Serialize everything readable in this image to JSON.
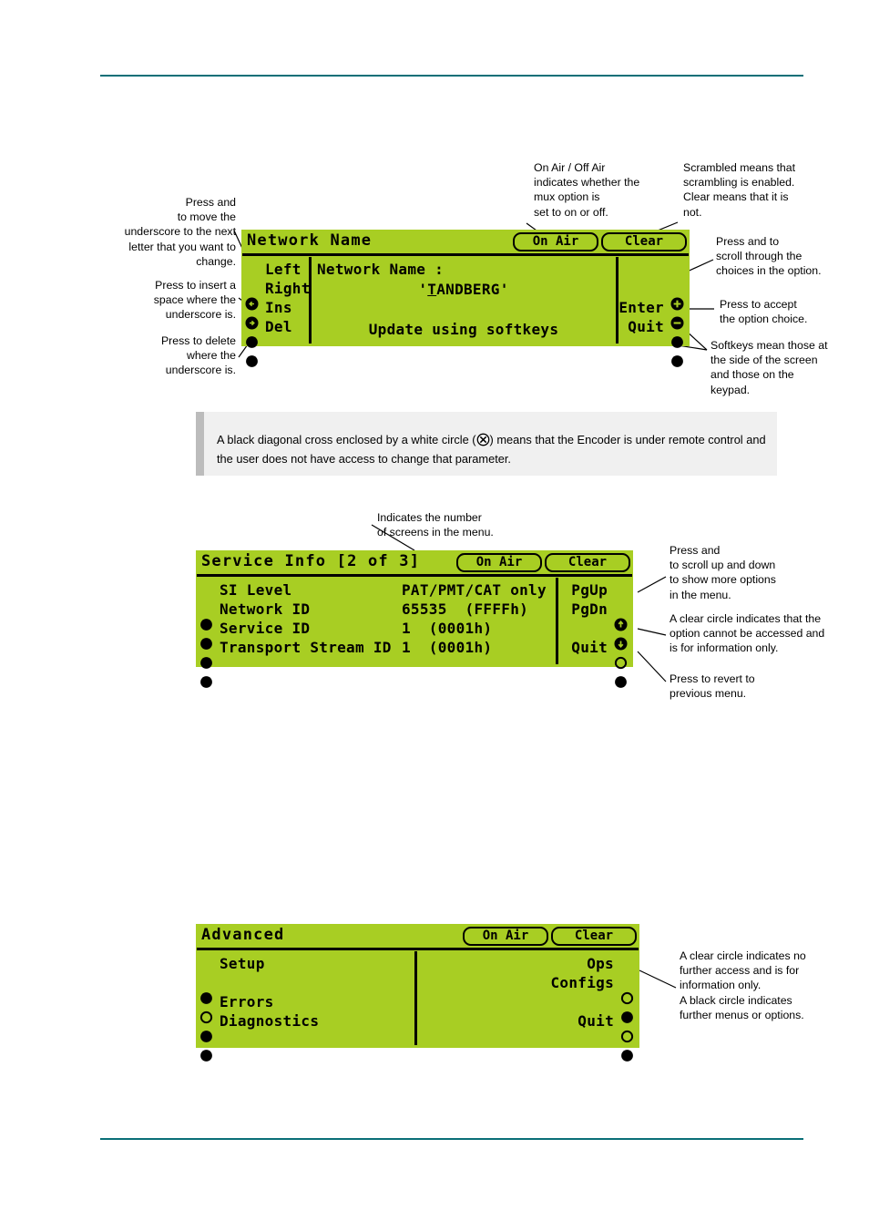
{
  "page": {
    "rule_color": "#0a6f77",
    "lcd_color": "#a8ce23"
  },
  "screens": {
    "network_name": {
      "title": "Network Name",
      "badge_on_air": "On Air",
      "badge_clear": "Clear",
      "left_keys": [
        {
          "label": "Left",
          "icon": "circle-arrow-left-icon"
        },
        {
          "label": "Right",
          "icon": "circle-arrow-right-icon"
        },
        {
          "label": "Ins",
          "icon": "filled-circle-icon"
        },
        {
          "label": "Del",
          "icon": "filled-circle-icon"
        }
      ],
      "field_label": "Network Name :",
      "field_value_prefix": "'",
      "field_value_cursor": "T",
      "field_value_rest": "ANDBERG'",
      "hint": "Update using softkeys",
      "right_keys": [
        {
          "label": "",
          "icon": "circle-plus-icon"
        },
        {
          "label": "",
          "icon": "circle-minus-icon"
        },
        {
          "label": "Enter",
          "icon": "filled-circle-icon"
        },
        {
          "label": "Quit",
          "icon": "filled-circle-icon"
        }
      ]
    },
    "service_info": {
      "title": "Service Info [2 of 3]",
      "badge_on_air": "On Air",
      "badge_clear": "Clear",
      "rows": [
        {
          "icon": "filled-circle-icon",
          "label": "SI Level",
          "value": "PAT/PMT/CAT only"
        },
        {
          "icon": "filled-circle-icon",
          "label": "Network ID",
          "value": "65535  (FFFFh)"
        },
        {
          "icon": "filled-circle-icon",
          "label": "Service ID",
          "value": "1  (0001h)"
        },
        {
          "icon": "filled-circle-icon",
          "label": "Transport Stream ID",
          "value": "1  (0001h)"
        }
      ],
      "right_keys": [
        {
          "label": "PgUp",
          "icon": "circle-arrow-up-icon"
        },
        {
          "label": "PgDn",
          "icon": "circle-arrow-down-icon"
        },
        {
          "label": "",
          "icon": "clear-circle-icon"
        },
        {
          "label": "Quit",
          "icon": "filled-circle-icon"
        }
      ]
    },
    "advanced": {
      "title": "Advanced",
      "badge_on_air": "On Air",
      "badge_clear": "Clear",
      "left_keys": [
        {
          "label": "Setup",
          "icon": "filled-circle-icon"
        },
        {
          "label": "",
          "icon": "clear-circle-icon"
        },
        {
          "label": "Errors",
          "icon": "filled-circle-icon"
        },
        {
          "label": "Diagnostics",
          "icon": "filled-circle-icon"
        }
      ],
      "right_keys": [
        {
          "label": "Ops",
          "icon": "clear-circle-icon"
        },
        {
          "label": "Configs",
          "icon": "filled-circle-icon"
        },
        {
          "label": "",
          "icon": "clear-circle-icon"
        },
        {
          "label": "Quit",
          "icon": "filled-circle-icon"
        }
      ]
    }
  },
  "callouts": {
    "press_left_right": "Press         and\nto move the\nunderscore to the next\nletter that you want to\nchange.",
    "press_ins": "Press        to insert a\nspace where the\nunderscore is.",
    "press_del": "Press        to delete\nwhere the\nunderscore is.",
    "on_air_off_air": "On Air / Off Air\nindicates whether the\nmux           option is\nset to on or off.",
    "scrambled": "Scrambled means that\nscrambling is enabled.\nClear means that it is\nnot.",
    "press_scroll_choices": "Press  and  to\nscroll through the\nchoices in the option.",
    "press_accept": "Press          to accept\nthe option choice.",
    "softkeys_mean": "Softkeys mean those at\nthe side of the screen\nand those on the\nkeypad.",
    "indicates_screens": "Indicates the number\nof screens in the menu.",
    "press_pgup_pgdn": "Press           and\nto scroll up and down\nto show more options\nin the menu.",
    "clear_circle_info": "A clear circle indicates that the\noption cannot be accessed and\nis for information only.",
    "press_revert": "Press         to revert to\nprevious menu.",
    "advanced_circles": "A clear circle indicates no\nfurther access and is for\ninformation only.\nA black circle indicates\nfurther menus or options."
  },
  "note": {
    "text_before": "A black diagonal cross enclosed by a white circle (",
    "text_after": ") means that the Encoder is under remote control and the user does not have access to change that parameter."
  }
}
